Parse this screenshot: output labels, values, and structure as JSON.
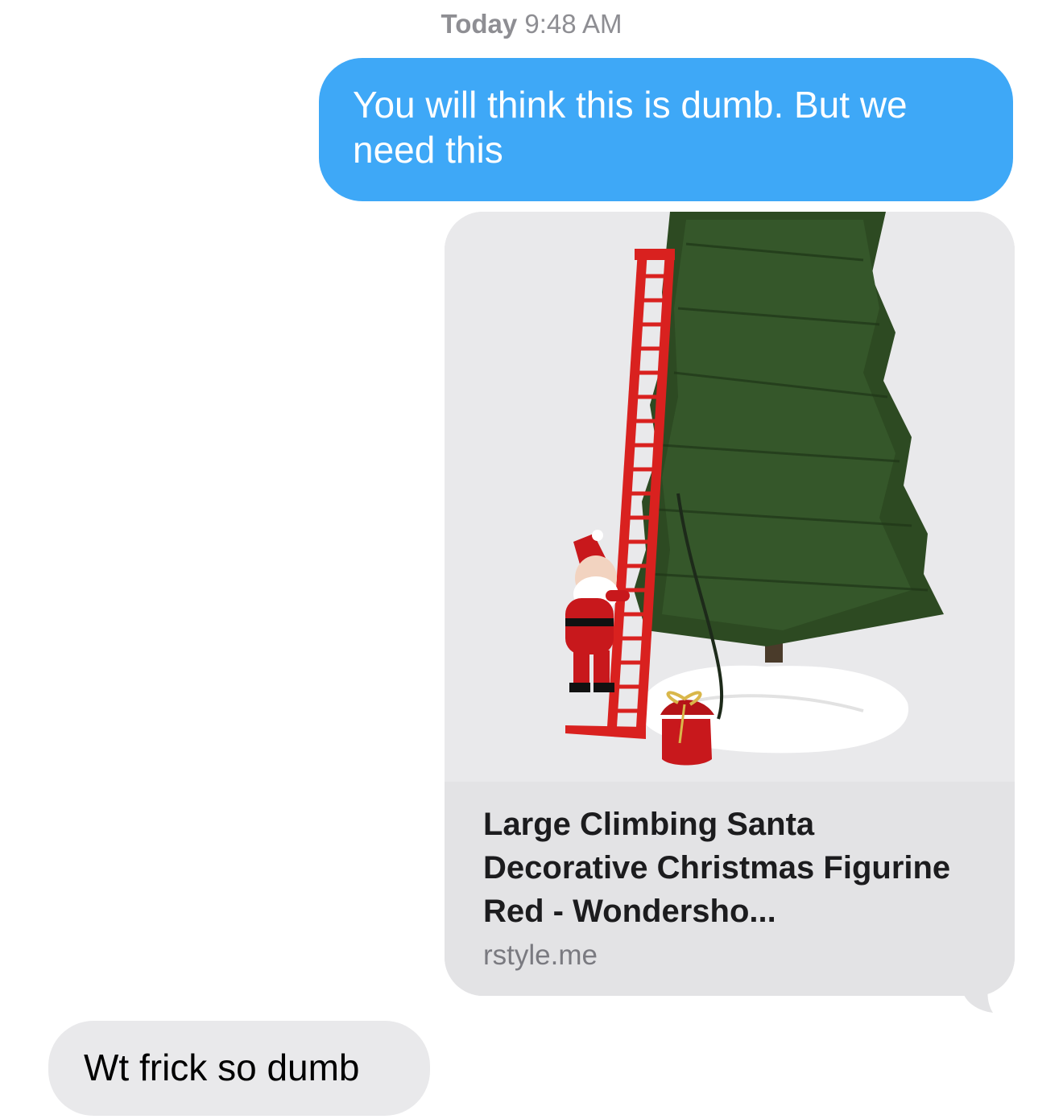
{
  "timestamp": {
    "day": "Today",
    "time": "9:48 AM"
  },
  "messages": [
    {
      "direction": "outgoing",
      "text": "You will think this is dumb. But we need this"
    },
    {
      "direction": "outgoing",
      "type": "link_preview",
      "image": "climbing-santa-ladder-christmas-tree-image",
      "title": "Large Climbing Santa Decorative Christmas Figurine Red - Wondersho...",
      "domain": "rstyle.me"
    },
    {
      "direction": "incoming",
      "text": "Wt frick so dumb"
    }
  ],
  "colors": {
    "outgoing_bubble": "#3ea8f7",
    "incoming_bubble": "#e9e9eb",
    "link_card": "#e3e3e5",
    "timestamp_text": "#8e8e93"
  }
}
